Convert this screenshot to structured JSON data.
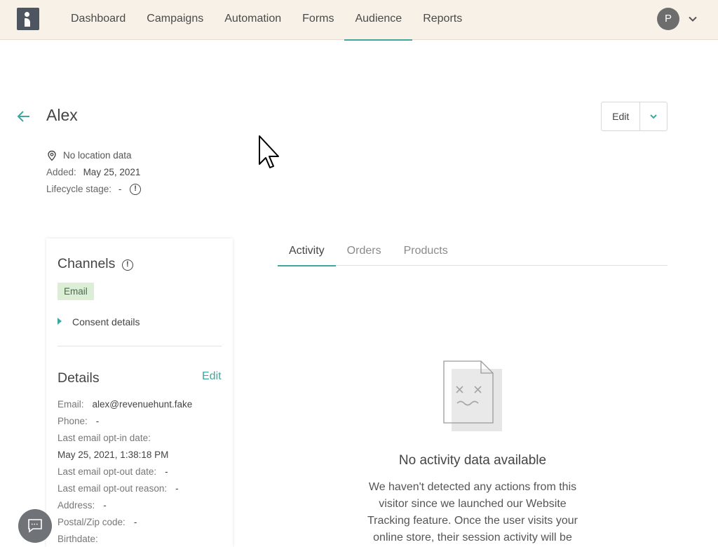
{
  "nav": {
    "items": [
      {
        "label": "Dashboard"
      },
      {
        "label": "Campaigns"
      },
      {
        "label": "Automation"
      },
      {
        "label": "Forms"
      },
      {
        "label": "Audience",
        "active": true
      },
      {
        "label": "Reports"
      }
    ],
    "avatar_initial": "P"
  },
  "contact": {
    "name": "Alex",
    "edit_label": "Edit",
    "location": "No location data",
    "added_label": "Added:",
    "added_value": "May 25, 2021",
    "lifecycle_label": "Lifecycle stage:",
    "lifecycle_value": "-"
  },
  "channels": {
    "title": "Channels",
    "chip": "Email",
    "consent_label": "Consent details"
  },
  "details": {
    "title": "Details",
    "edit_label": "Edit",
    "rows": [
      {
        "label": "Email:",
        "value": "alex@revenuehunt.fake"
      },
      {
        "label": "Phone:",
        "value": "-"
      },
      {
        "label": "Last email opt-in date:",
        "value": ""
      },
      {
        "label": "",
        "value": "May 25, 2021, 1:38:18 PM"
      },
      {
        "label": "Last email opt-out date:",
        "value": "-"
      },
      {
        "label": "Last email opt-out reason:",
        "value": "-"
      },
      {
        "label": "Address:",
        "value": "-"
      },
      {
        "label": "Postal/Zip code:",
        "value": "-"
      },
      {
        "label": "Birthdate:",
        "value": ""
      }
    ]
  },
  "tabs": [
    {
      "label": "Activity",
      "active": true
    },
    {
      "label": "Orders"
    },
    {
      "label": "Products"
    }
  ],
  "empty_state": {
    "title": "No activity data available",
    "body": "We haven't detected any actions from this visitor since we launched our Website Tracking feature. Once the user visits your online store, their session activity will be"
  },
  "colors": {
    "accent": "#3fa7a0",
    "topbar_bg": "#f8f1e7",
    "chip_bg": "#dcefd6"
  },
  "icons": [
    "logo-icon",
    "chevron-down-icon",
    "arrow-left-icon",
    "location-pin-icon",
    "info-icon",
    "triangle-right-icon",
    "empty-document-icon",
    "chat-icon",
    "mouse-cursor-icon"
  ]
}
